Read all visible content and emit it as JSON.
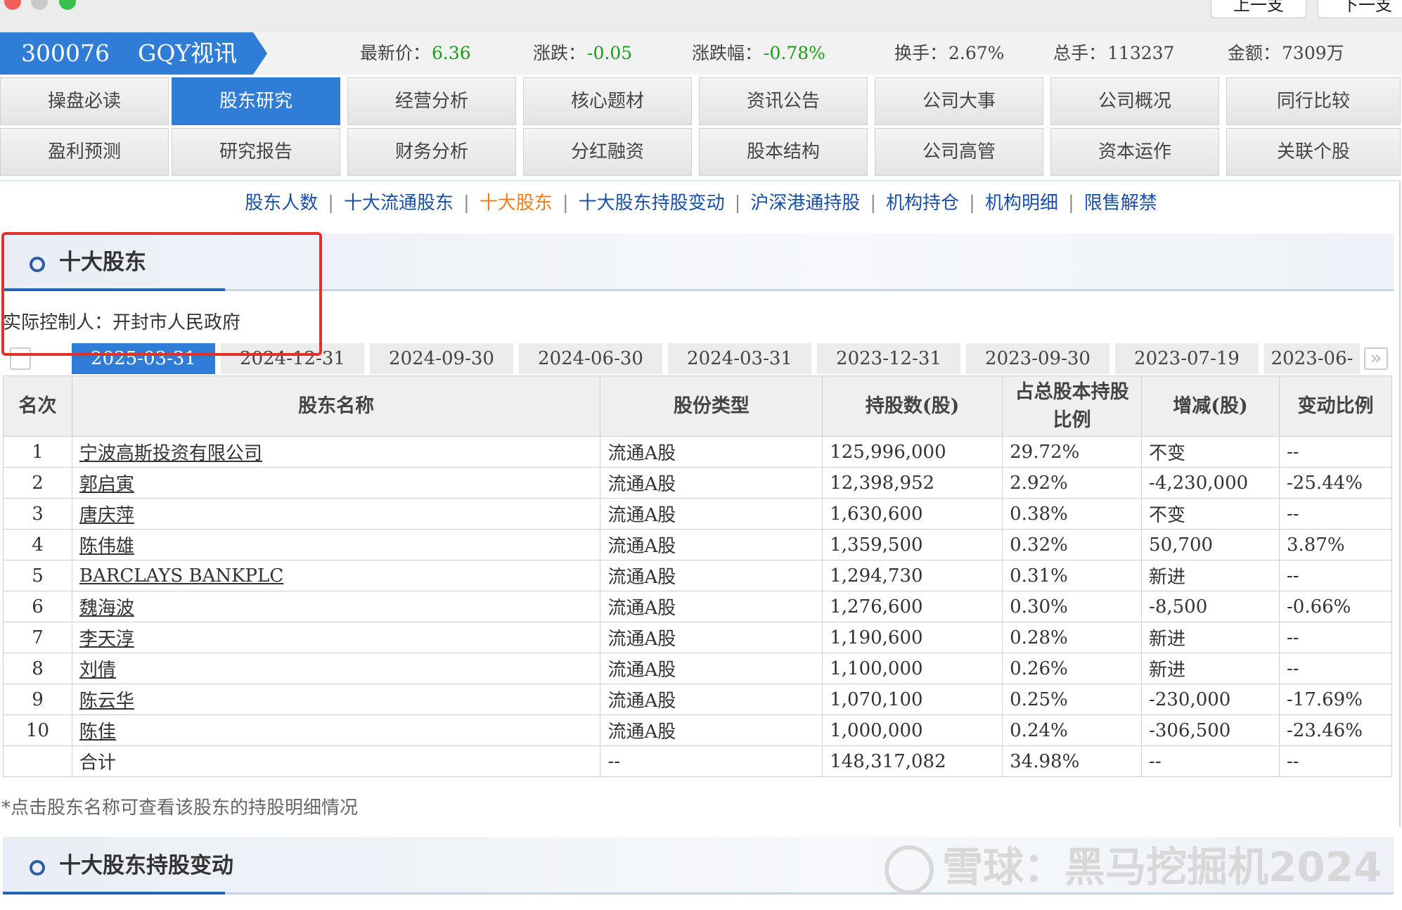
{
  "window": {
    "prev_label": "上一支",
    "next_label": "下一支"
  },
  "quote": {
    "code": "300076",
    "name": "GQY视讯",
    "items": [
      {
        "label": "最新价：",
        "value": "6.36",
        "color": "green"
      },
      {
        "label": "涨跌：",
        "value": "-0.05",
        "color": "green"
      },
      {
        "label": "涨跌幅：",
        "value": "-0.78%",
        "color": "green"
      },
      {
        "label": "换手：",
        "value": "2.67%",
        "color": "default"
      },
      {
        "label": "总手：",
        "value": "113237",
        "color": "default"
      },
      {
        "label": "金额：",
        "value": "7309万",
        "color": "default"
      }
    ]
  },
  "menu": {
    "row1": [
      "操盘必读",
      "股东研究",
      "经营分析",
      "核心题材",
      "资讯公告",
      "公司大事",
      "公司概况",
      "同行比较"
    ],
    "row2": [
      "盈利预测",
      "研究报告",
      "财务分析",
      "分红融资",
      "股本结构",
      "公司高管",
      "资本运作",
      "关联个股"
    ],
    "active": "股东研究"
  },
  "subnav": {
    "items": [
      "股东人数",
      "十大流通股东",
      "十大股东",
      "十大股东持股变动",
      "沪深港通持股",
      "机构持仓",
      "机构明细",
      "限售解禁"
    ],
    "current": "十大股东"
  },
  "section1": {
    "title": "十大股东",
    "controller": "实际控制人：开封市人民政府"
  },
  "date_tabs": {
    "items": [
      "2025-03-31",
      "2024-12-31",
      "2024-09-30",
      "2024-06-30",
      "2024-03-31",
      "2023-12-31",
      "2023-09-30",
      "2023-07-19",
      "2023-06-"
    ],
    "active": "2025-03-31"
  },
  "table": {
    "headers": [
      "名次",
      "股东名称",
      "股份类型",
      "持股数(股)",
      "占总股本持股比例",
      "增减(股)",
      "变动比例"
    ],
    "rows": [
      {
        "rank": "1",
        "name": "宁波高斯投资有限公司",
        "type": "流通A股",
        "shares": "125,996,000",
        "ratio": "29.72%",
        "change": "不变",
        "change_color": "default",
        "pct": "--",
        "pct_color": "default"
      },
      {
        "rank": "2",
        "name": "郭启寅",
        "type": "流通A股",
        "shares": "12,398,952",
        "ratio": "2.92%",
        "change": "-4,230,000",
        "change_color": "green",
        "pct": "-25.44%",
        "pct_color": "green"
      },
      {
        "rank": "3",
        "name": "唐庆萍",
        "type": "流通A股",
        "shares": "1,630,600",
        "ratio": "0.38%",
        "change": "不变",
        "change_color": "default",
        "pct": "--",
        "pct_color": "default"
      },
      {
        "rank": "4",
        "name": "陈伟雄",
        "type": "流通A股",
        "shares": "1,359,500",
        "ratio": "0.32%",
        "change": "50,700",
        "change_color": "red",
        "pct": "3.87%",
        "pct_color": "red"
      },
      {
        "rank": "5",
        "name": "BARCLAYS BANKPLC",
        "type": "流通A股",
        "shares": "1,294,730",
        "ratio": "0.31%",
        "change": "新进",
        "change_color": "red",
        "pct": "--",
        "pct_color": "red"
      },
      {
        "rank": "6",
        "name": "魏海波",
        "type": "流通A股",
        "shares": "1,276,600",
        "ratio": "0.30%",
        "change": "-8,500",
        "change_color": "green",
        "pct": "-0.66%",
        "pct_color": "green"
      },
      {
        "rank": "7",
        "name": "李天淳",
        "type": "流通A股",
        "shares": "1,190,600",
        "ratio": "0.28%",
        "change": "新进",
        "change_color": "red",
        "pct": "--",
        "pct_color": "red"
      },
      {
        "rank": "8",
        "name": "刘倩",
        "type": "流通A股",
        "shares": "1,100,000",
        "ratio": "0.26%",
        "change": "新进",
        "change_color": "red",
        "pct": "--",
        "pct_color": "red"
      },
      {
        "rank": "9",
        "name": "陈云华",
        "type": "流通A股",
        "shares": "1,070,100",
        "ratio": "0.25%",
        "change": "-230,000",
        "change_color": "green",
        "pct": "-17.69%",
        "pct_color": "green"
      },
      {
        "rank": "10",
        "name": "陈佳",
        "type": "流通A股",
        "shares": "1,000,000",
        "ratio": "0.24%",
        "change": "-306,500",
        "change_color": "green",
        "pct": "-23.46%",
        "pct_color": "green"
      }
    ],
    "total": {
      "label": "合计",
      "type": "--",
      "shares": "148,317,082",
      "ratio": "34.98%",
      "change": "--",
      "pct": "--"
    }
  },
  "note": "*点击股东名称可查看该股东的持股明细情况",
  "section2": {
    "title": "十大股东持股变动"
  },
  "watermark": "雪球：黑马挖掘机2024",
  "colors": {
    "accent": "#2f7dd6",
    "green": "#1a9e1a",
    "red": "#e02020",
    "orange": "#f07c1a",
    "link": "#1a4fa8"
  }
}
